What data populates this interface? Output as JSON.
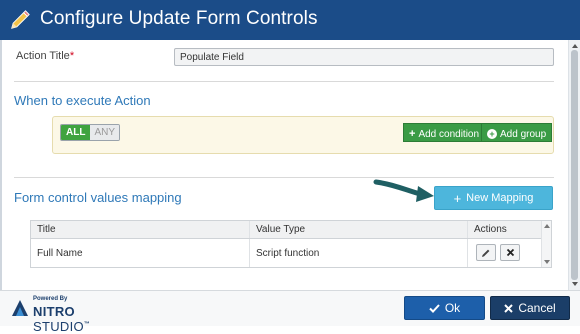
{
  "dialog": {
    "title": "Configure Update Form Controls"
  },
  "action_title": {
    "label": "Action Title",
    "required_mark": "*",
    "value": "Populate Field"
  },
  "when_section": {
    "title": "When to execute Action",
    "toggle_all": "ALL",
    "toggle_any": "ANY",
    "add_condition": "Add condition",
    "add_group": "Add group"
  },
  "mapping_section": {
    "title": "Form control values mapping",
    "new_mapping": "New Mapping",
    "columns": [
      "Title",
      "Value Type",
      "Actions"
    ],
    "rows": [
      {
        "title": "Full Name",
        "value_type": "Script function"
      }
    ]
  },
  "footer": {
    "powered_by": "Powered By",
    "brand_nitro": "NITRO",
    "brand_studio": "STUDIO",
    "trademark": "™",
    "ok": "Ok",
    "cancel": "Cancel"
  },
  "colors": {
    "title_bar": "#1b4c88",
    "section_title": "#2f79b8",
    "green_button": "#3a9b45",
    "new_mapping": "#4db6dc",
    "ok_button": "#1d5faa",
    "cancel_button": "#1b3e68",
    "condition_panel": "#fcf8e7"
  },
  "icons": {
    "title": "pencil-icon",
    "add_condition": "plus-square-icon",
    "add_group": "plus-circle-icon",
    "new_mapping": "plus-icon",
    "edit": "pencil-icon",
    "delete": "close-icon",
    "ok": "check-icon",
    "cancel": "close-icon"
  }
}
